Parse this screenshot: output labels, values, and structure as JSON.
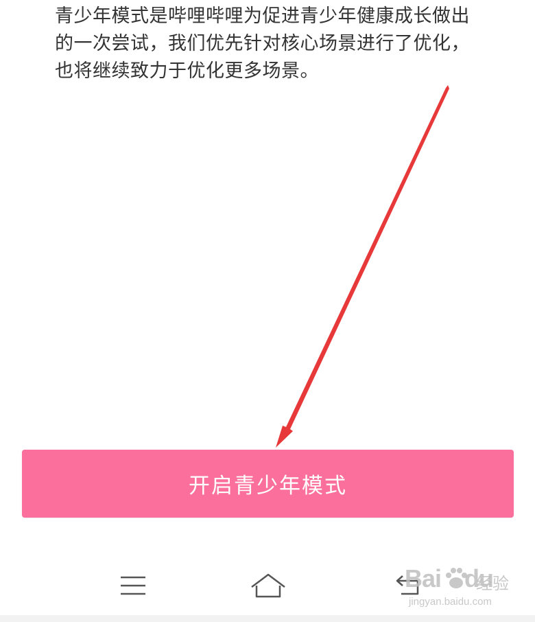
{
  "description": {
    "line1": "青少年模式是哔哩哔哩为促进青少年健康成长做出",
    "line2": "的一次尝试，我们优先针对核心场景进行了优化，",
    "line3": "也将继续致力于优化更多场景。"
  },
  "main": {
    "enable_button_label": "开启青少年模式"
  },
  "colors": {
    "button": "#fb6f9c",
    "arrow": "#e8393a",
    "text": "#333333"
  },
  "navbar": {
    "icons": [
      "menu-icon",
      "home-icon",
      "back-icon"
    ]
  },
  "watermark": {
    "logo": "Bai",
    "logo2": "du",
    "text": "经验",
    "url": "jingyan.baidu.com"
  }
}
